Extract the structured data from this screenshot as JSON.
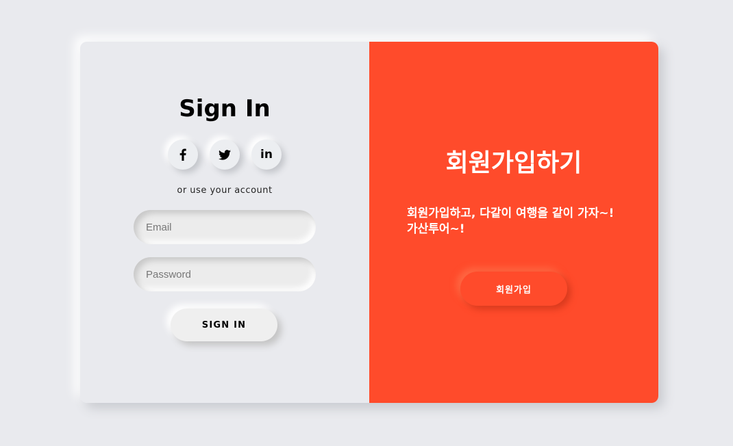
{
  "signin": {
    "title": "Sign In",
    "social": [
      {
        "name": "facebook-icon"
      },
      {
        "name": "twitter-icon"
      },
      {
        "name": "linkedin-icon",
        "label": "in"
      }
    ],
    "or_text": "or use your account",
    "email_placeholder": "Email",
    "password_placeholder": "Password",
    "button_label": "SIGN IN"
  },
  "signup_panel": {
    "title": "회원가입하기",
    "description": "회원가입하고, 다같이 여행을 같이 가자~! 가산투어~!",
    "button_label": "회원가입",
    "accent_color": "#ff4b2b"
  }
}
